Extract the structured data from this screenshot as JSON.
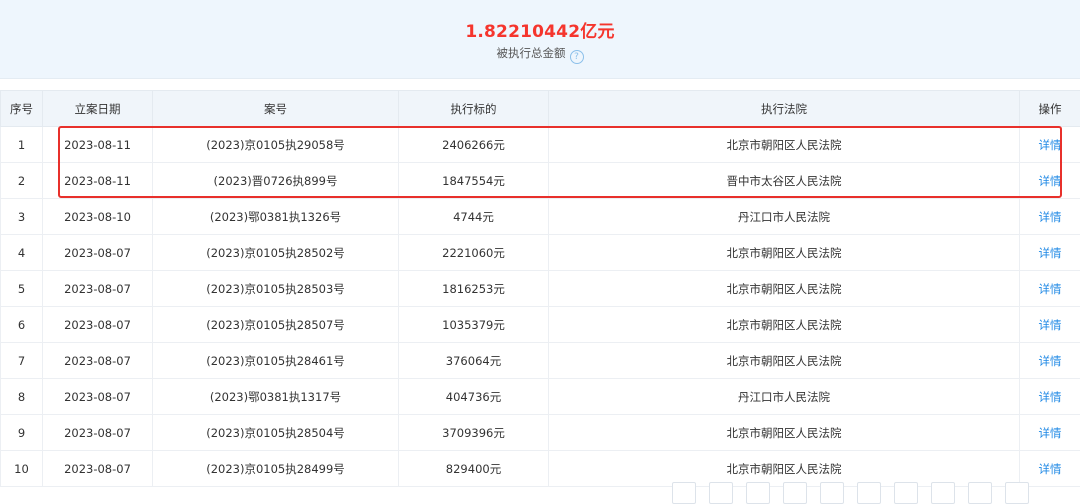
{
  "summary": {
    "total_amount": "1.82210442亿元",
    "total_label": "被执行总金额",
    "help_icon": "?"
  },
  "table": {
    "headers": [
      "序号",
      "立案日期",
      "案号",
      "执行标的",
      "执行法院",
      "操作"
    ],
    "rows": [
      {
        "index": "1",
        "date": "2023-08-11",
        "case_no": "(2023)京0105执29058号",
        "amount": "2406266元",
        "court": "北京市朝阳区人民法院",
        "action": "详情"
      },
      {
        "index": "2",
        "date": "2023-08-11",
        "case_no": "(2023)晋0726执899号",
        "amount": "1847554元",
        "court": "晋中市太谷区人民法院",
        "action": "详情"
      },
      {
        "index": "3",
        "date": "2023-08-10",
        "case_no": "(2023)鄂0381执1326号",
        "amount": "4744元",
        "court": "丹江口市人民法院",
        "action": "详情"
      },
      {
        "index": "4",
        "date": "2023-08-07",
        "case_no": "(2023)京0105执28502号",
        "amount": "2221060元",
        "court": "北京市朝阳区人民法院",
        "action": "详情"
      },
      {
        "index": "5",
        "date": "2023-08-07",
        "case_no": "(2023)京0105执28503号",
        "amount": "1816253元",
        "court": "北京市朝阳区人民法院",
        "action": "详情"
      },
      {
        "index": "6",
        "date": "2023-08-07",
        "case_no": "(2023)京0105执28507号",
        "amount": "1035379元",
        "court": "北京市朝阳区人民法院",
        "action": "详情"
      },
      {
        "index": "7",
        "date": "2023-08-07",
        "case_no": "(2023)京0105执28461号",
        "amount": "376064元",
        "court": "北京市朝阳区人民法院",
        "action": "详情"
      },
      {
        "index": "8",
        "date": "2023-08-07",
        "case_no": "(2023)鄂0381执1317号",
        "amount": "404736元",
        "court": "丹江口市人民法院",
        "action": "详情"
      },
      {
        "index": "9",
        "date": "2023-08-07",
        "case_no": "(2023)京0105执28504号",
        "amount": "3709396元",
        "court": "北京市朝阳区人民法院",
        "action": "详情"
      },
      {
        "index": "10",
        "date": "2023-08-07",
        "case_no": "(2023)京0105执28499号",
        "amount": "829400元",
        "court": "北京市朝阳区人民法院",
        "action": "详情"
      }
    ]
  },
  "colors": {
    "amount": "#f5352d",
    "link": "#1e88e5",
    "highlight": "#e8302b",
    "summary_bg": "#eef6fd",
    "header_bg": "#f0f5fa"
  }
}
